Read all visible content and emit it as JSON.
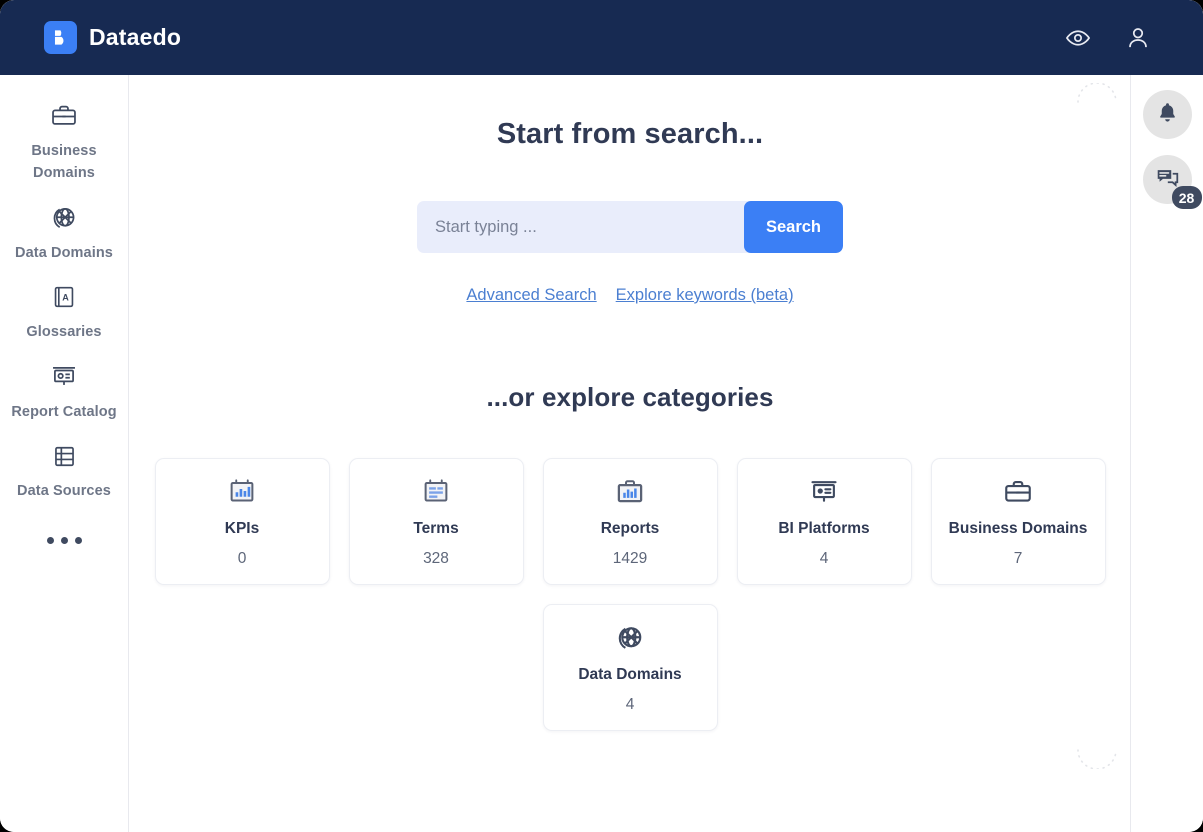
{
  "header": {
    "brand": "Dataedo",
    "logo_icon": "database-logo-icon",
    "preview_icon": "eye-icon",
    "account_icon": "user-icon"
  },
  "sidebar": {
    "items": [
      {
        "label": "Business Domains",
        "icon": "briefcase-icon"
      },
      {
        "label": "Data Domains",
        "icon": "globe-network-icon"
      },
      {
        "label": "Glossaries",
        "icon": "book-a-icon"
      },
      {
        "label": "Report Catalog",
        "icon": "presentation-icon"
      },
      {
        "label": "Data Sources",
        "icon": "table-rows-icon"
      }
    ],
    "more_label": "•••"
  },
  "main": {
    "title": "Start from search...",
    "search": {
      "placeholder": "Start typing ...",
      "value": "",
      "button_label": "Search"
    },
    "links": [
      {
        "label": "Advanced Search"
      },
      {
        "label": "Explore keywords (beta)"
      }
    ],
    "subtitle": "...or explore categories",
    "categories": [
      {
        "label": "KPIs",
        "count": "0",
        "icon": "kpi-chart-icon"
      },
      {
        "label": "Terms",
        "count": "328",
        "icon": "terms-card-icon"
      },
      {
        "label": "Reports",
        "count": "1429",
        "icon": "report-briefcase-chart-icon"
      },
      {
        "label": "BI Platforms",
        "count": "4",
        "icon": "presentation-pie-icon"
      },
      {
        "label": "Business Domains",
        "count": "7",
        "icon": "briefcase-icon"
      },
      {
        "label": "Data Domains",
        "count": "4",
        "icon": "globe-network-icon"
      }
    ]
  },
  "rail": {
    "notifications_icon": "bell-icon",
    "comments_icon": "comments-icon",
    "comments_badge": "28"
  },
  "colors": {
    "header_bg": "#172a52",
    "accent": "#3b7ff5",
    "search_bg": "#e9edfb",
    "link": "#4b7fd1",
    "text_dark": "#303a54",
    "text_muted": "#6e7687"
  }
}
